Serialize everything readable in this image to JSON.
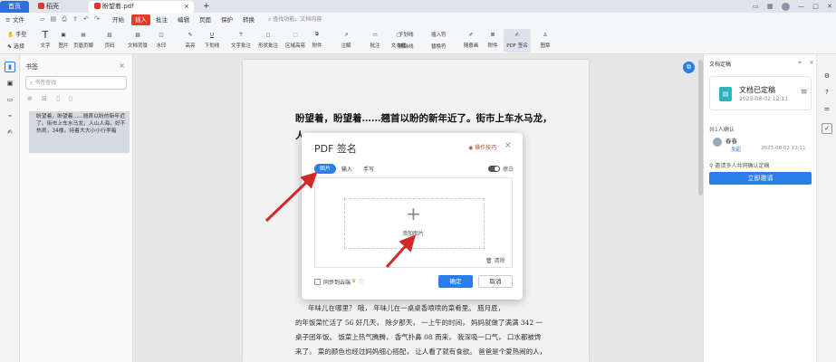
{
  "tabs": {
    "home": "首页",
    "tab1": "稻壳",
    "tab2": "盼望着.pdf",
    "add": "+"
  },
  "menubar": {
    "file": "文件",
    "items": [
      "开始",
      "插入",
      "批注",
      "编辑",
      "页面",
      "保护",
      "转换"
    ],
    "search_placeholder": "查找功能、文档内容"
  },
  "ribbon": {
    "hand": "手型",
    "select": "选择",
    "buttons": [
      "文字",
      "图片",
      "页眉页脚",
      "页码",
      "文档背景",
      "水印",
      "高亮",
      "下划线",
      "文字批注",
      "形状批注",
      "区域高亮",
      "附件",
      "注解",
      "批注",
      "文本框",
      "随意画",
      "PDF 签名",
      "图章"
    ],
    "sub": {
      "underline": "下划线",
      "strike": "删除线",
      "insert_text": "插入符",
      "replace": "替换符"
    }
  },
  "bookmark": {
    "title": "书签",
    "search_placeholder": "书签查找",
    "item": "盼望着，盼望着......翘首以盼的新年近了。街市上车水马龙，人山人海，好不热闹，34楼。持着大大小小行李箱"
  },
  "document": {
    "heading": [
      "盼望着，盼望着……翘首以盼的新年近了。街市上车水马龙，",
      "人"
    ],
    "body": [
      "年味儿在哪里？ 哦， 年味儿在一桌桌香喷喷的菜肴里。 腊月底，",
      "的年饭菜忙活了 56 好几天， 除夕那天， 一上午的时间， 妈妈就做了满满 342 一",
      "桌子团年饭。 饭菜上热气腾腾， 香气扑鼻 08 而来， 我深吸一口气， 口水都被馋",
      "来了， 菜的颜色也经过妈妈细心搭配， 让人看了就有食欲。 爸爸是个爱热闹的人，"
    ]
  },
  "dialog": {
    "title": "PDF 签名",
    "tips": "操作技巧",
    "tabs": [
      "图片",
      "输入",
      "手写"
    ],
    "erase_label": "擦白",
    "add_image": "添加图片",
    "clear": "清除",
    "sync": "同步到云端",
    "ok": "确定",
    "cancel": "取消"
  },
  "rightpanel": {
    "title": "文档定稿",
    "status": "文档已定稿",
    "date": "2023-08-02 12:11",
    "count_label": "共1人确认",
    "user": "春春",
    "user_action": "发起",
    "user_date": "2023-08-02 12:11",
    "invite_text": "邀请多人共同确认定稿",
    "invite_button": "立即邀请"
  },
  "colors": {
    "accent": "#2b7de9",
    "arrow": "#d12a2a",
    "highlight": "#d33c2a"
  }
}
